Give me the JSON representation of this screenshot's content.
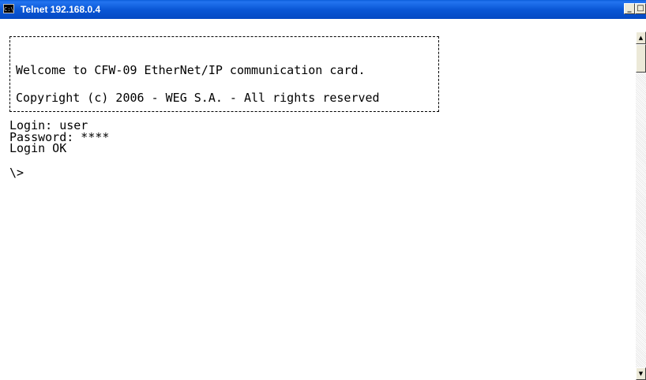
{
  "window": {
    "title": "Telnet 192.168.0.4",
    "icon": "console-icon",
    "icon_glyph": "C:\\",
    "buttons": {
      "minimize": "_",
      "maximize": "□",
      "close": "×"
    },
    "titlebar_color": "#0a5bd6"
  },
  "console": {
    "banner": {
      "line1": "Welcome to CFW-09 EtherNet/IP communication card.",
      "line2": "Copyright (c) 2006 - WEG S.A. - All rights reserved"
    },
    "session": [
      "Login: user",
      "Password: ****",
      "Login OK",
      "\\>"
    ]
  },
  "scrollbar": {
    "up": "▲",
    "down": "▼"
  }
}
